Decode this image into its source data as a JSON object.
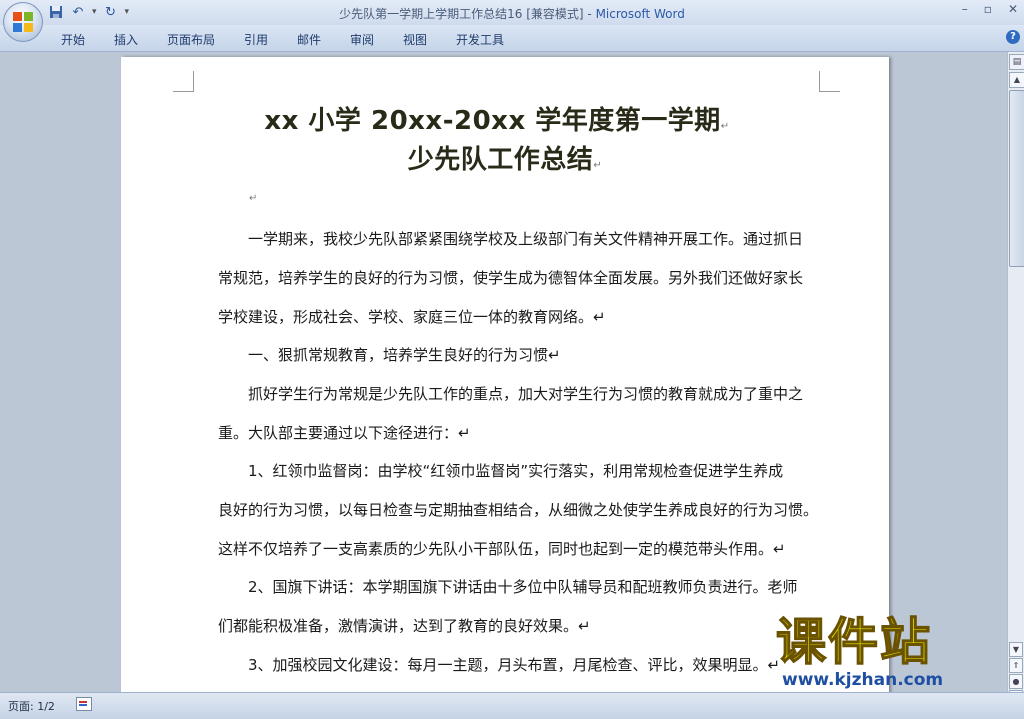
{
  "window": {
    "title_doc": "少先队第一学期上学期工作总结16 [兼容模式]",
    "title_sep": " - ",
    "title_app": "Microsoft Word",
    "controls": [
      "–",
      "▫",
      "✕"
    ]
  },
  "quick_access": {
    "icons": [
      "save-icon",
      "undo-icon",
      "redo-icon",
      "customize-icon"
    ]
  },
  "ribbon": {
    "tabs": [
      "开始",
      "插入",
      "页面布局",
      "引用",
      "邮件",
      "审阅",
      "视图",
      "开发工具"
    ],
    "help": "?"
  },
  "document": {
    "title_line1": "xx 小学 20xx-20xx 学年度第一学期",
    "title_line2": "少先队工作总结",
    "para_mark": "↵",
    "lines": [
      "　　一学期来，我校少先队部紧紧围绕学校及上级部门有关文件精神开展工作。通过抓日",
      "常规范，培养学生的良好的行为习惯，使学生成为德智体全面发展。另外我们还做好家长",
      "学校建设，形成社会、学校、家庭三位一体的教育网络。↵",
      "　　一、狠抓常规教育，培养学生良好的行为习惯↵",
      "　　抓好学生行为常规是少先队工作的重点，加大对学生行为习惯的教育就成为了重中之",
      "重。大队部主要通过以下途径进行：↵",
      "　　1、红领巾监督岗：由学校“红领巾监督岗”实行落实，利用常规检查促进学生养成",
      "良好的行为习惯，以每日检查与定期抽查相结合，从细微之处使学生养成良好的行为习惯。",
      "这样不仅培养了一支高素质的少先队小干部队伍，同时也起到一定的模范带头作用。↵",
      "　　2、国旗下讲话：本学期国旗下讲话由十多位中队辅导员和配班教师负责进行。老师",
      "们都能积极准备，激情演讲，达到了教育的良好效果。↵",
      "　　3、加强校园文化建设：每月一主题，月头布置，月尾检查、评比，效果明显。↵"
    ]
  },
  "status": {
    "page": "页面: 1/2"
  },
  "watermark": {
    "text": "课件站",
    "url": "www.kjzhan.com"
  },
  "colors": {
    "ribbon_bg": "#d5e1f2",
    "title_app": "#2b5aa8",
    "watermark_yellow": "#e5ec00",
    "watermark_blue": "#1e4fa3"
  }
}
